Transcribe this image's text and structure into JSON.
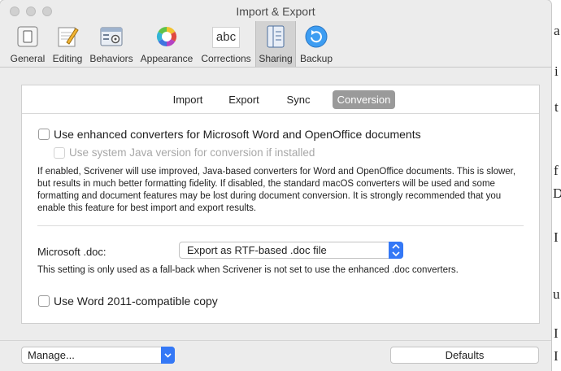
{
  "window": {
    "title": "Import & Export"
  },
  "toolbar": {
    "items": [
      {
        "label": "General",
        "icon": "general-icon",
        "selected": false
      },
      {
        "label": "Editing",
        "icon": "pencil-icon",
        "selected": false
      },
      {
        "label": "Behaviors",
        "icon": "behaviors-icon",
        "selected": false
      },
      {
        "label": "Appearance",
        "icon": "color-wheel-icon",
        "selected": false
      },
      {
        "label": "Corrections",
        "icon": "abc-icon",
        "selected": false
      },
      {
        "label": "Sharing",
        "icon": "sharing-icon",
        "selected": true
      },
      {
        "label": "Backup",
        "icon": "backup-icon",
        "selected": false
      }
    ],
    "corrections_icon_text": "abc"
  },
  "tabs": {
    "items": [
      "Import",
      "Export",
      "Sync",
      "Conversion"
    ],
    "active": "Conversion"
  },
  "conversion": {
    "enhanced_label": "Use enhanced converters for Microsoft Word and OpenOffice documents",
    "enhanced_checked": false,
    "java_label": "Use system Java version for conversion if installed",
    "java_checked": false,
    "java_enabled": false,
    "description": "If enabled, Scrivener will use improved, Java-based converters for Word and OpenOffice documents. This is slower, but results in much better formatting fidelity. If disabled, the standard macOS converters will be used and some formatting and document features may be lost during document conversion. It is strongly recommended that you enable this feature for best import and export results.",
    "doc_label": "Microsoft .doc:",
    "doc_value": "Export as RTF-based .doc file",
    "doc_note": "This setting is only used as a fall-back when Scrivener is not set to use the enhanced .doc converters.",
    "word2011_label": "Use Word 2011-compatible copy",
    "word2011_checked": false
  },
  "footer": {
    "manage_label": "Manage...",
    "defaults_label": "Defaults"
  },
  "colors": {
    "accent": "#3478f6",
    "window_bg": "#ececec",
    "tab_active": "#9a9a9a"
  },
  "background_fragments": [
    "a",
    "i",
    "t",
    "f",
    "D",
    "I",
    "u",
    "I",
    "I"
  ]
}
